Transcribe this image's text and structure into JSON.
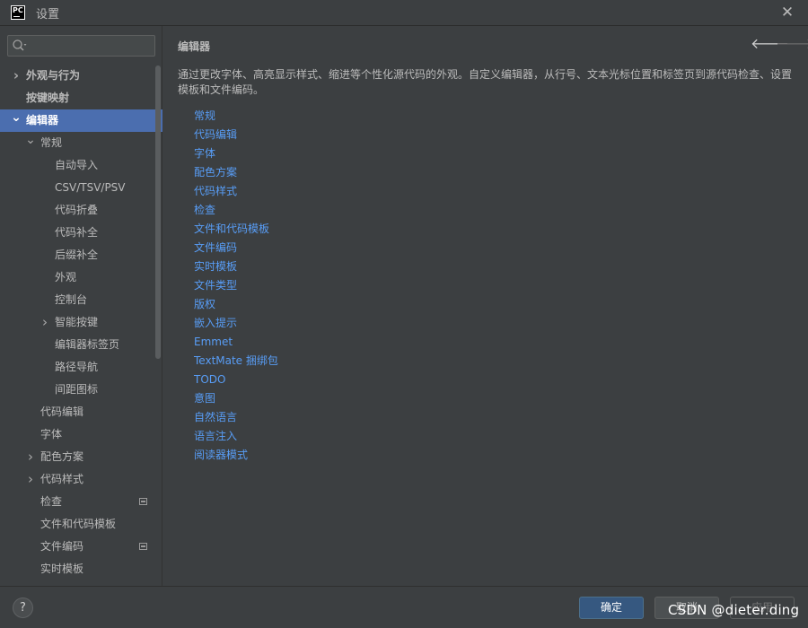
{
  "window": {
    "title": "设置",
    "app_icon": "pycharm-logo",
    "app_icon_text": "PC",
    "close_icon": "close-icon"
  },
  "search": {
    "value": "",
    "placeholder": "",
    "icon": "search-icon"
  },
  "sidebar": {
    "items": [
      {
        "label": "外观与行为",
        "level": 0,
        "chevron": "right",
        "bold": true,
        "selected": false,
        "badge": false
      },
      {
        "label": "按键映射",
        "level": 0,
        "chevron": "none",
        "bold": true,
        "selected": false,
        "badge": false
      },
      {
        "label": "编辑器",
        "level": 0,
        "chevron": "down",
        "bold": true,
        "selected": true,
        "badge": false
      },
      {
        "label": "常规",
        "level": 1,
        "chevron": "down",
        "bold": false,
        "selected": false,
        "badge": false
      },
      {
        "label": "自动导入",
        "level": 2,
        "chevron": "none",
        "bold": false,
        "selected": false,
        "badge": false
      },
      {
        "label": "CSV/TSV/PSV",
        "level": 2,
        "chevron": "none",
        "bold": false,
        "selected": false,
        "badge": false
      },
      {
        "label": "代码折叠",
        "level": 2,
        "chevron": "none",
        "bold": false,
        "selected": false,
        "badge": false
      },
      {
        "label": "代码补全",
        "level": 2,
        "chevron": "none",
        "bold": false,
        "selected": false,
        "badge": false
      },
      {
        "label": "后缀补全",
        "level": 2,
        "chevron": "none",
        "bold": false,
        "selected": false,
        "badge": false
      },
      {
        "label": "外观",
        "level": 2,
        "chevron": "none",
        "bold": false,
        "selected": false,
        "badge": false
      },
      {
        "label": "控制台",
        "level": 2,
        "chevron": "none",
        "bold": false,
        "selected": false,
        "badge": false
      },
      {
        "label": "智能按键",
        "level": 2,
        "chevron": "right",
        "bold": false,
        "selected": false,
        "badge": false
      },
      {
        "label": "编辑器标签页",
        "level": 2,
        "chevron": "none",
        "bold": false,
        "selected": false,
        "badge": false
      },
      {
        "label": "路径导航",
        "level": 2,
        "chevron": "none",
        "bold": false,
        "selected": false,
        "badge": false
      },
      {
        "label": "间距图标",
        "level": 2,
        "chevron": "none",
        "bold": false,
        "selected": false,
        "badge": false
      },
      {
        "label": "代码编辑",
        "level": 1,
        "chevron": "none",
        "bold": false,
        "selected": false,
        "badge": false
      },
      {
        "label": "字体",
        "level": 1,
        "chevron": "none",
        "bold": false,
        "selected": false,
        "badge": false
      },
      {
        "label": "配色方案",
        "level": 1,
        "chevron": "right",
        "bold": false,
        "selected": false,
        "badge": false
      },
      {
        "label": "代码样式",
        "level": 1,
        "chevron": "right",
        "bold": false,
        "selected": false,
        "badge": false
      },
      {
        "label": "检查",
        "level": 1,
        "chevron": "none",
        "bold": false,
        "selected": false,
        "badge": true
      },
      {
        "label": "文件和代码模板",
        "level": 1,
        "chevron": "none",
        "bold": false,
        "selected": false,
        "badge": false
      },
      {
        "label": "文件编码",
        "level": 1,
        "chevron": "none",
        "bold": false,
        "selected": false,
        "badge": true
      },
      {
        "label": "实时模板",
        "level": 1,
        "chevron": "none",
        "bold": false,
        "selected": false,
        "badge": false
      }
    ]
  },
  "main": {
    "title": "编辑器",
    "back_icon": "arrow-left-icon",
    "forward_icon": "arrow-right-icon",
    "description": "通过更改字体、高亮显示样式、缩进等个性化源代码的外观。自定义编辑器，从行号、文本光标位置和标签页到源代码检查、设置模板和文件编码。",
    "links": [
      "常规",
      "代码编辑",
      "字体",
      "配色方案",
      "代码样式",
      "检查",
      "文件和代码模板",
      "文件编码",
      "实时模板",
      "文件类型",
      "版权",
      "嵌入提示",
      "Emmet",
      "TextMate 捆绑包",
      "TODO",
      "意图",
      "自然语言",
      "语言注入",
      "阅读器模式"
    ]
  },
  "footer": {
    "help_label": "?",
    "ok_label": "确定",
    "cancel_label": "取消",
    "apply_label": "应用",
    "watermark": "CSDN @dieter.ding"
  },
  "colors": {
    "background": "#3c3f41",
    "selection": "#4b6eaf",
    "link": "#589df6",
    "primary_button": "#365880",
    "text": "#bbbbbb"
  }
}
